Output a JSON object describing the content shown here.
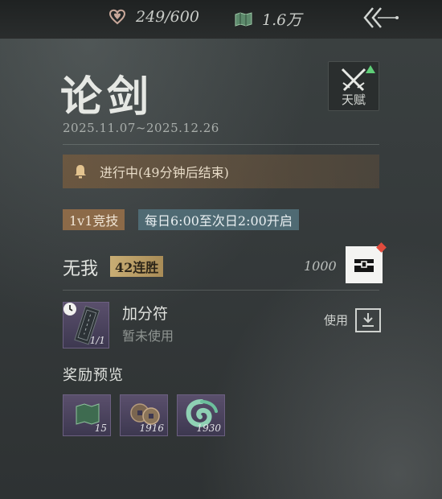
{
  "topbar": {
    "heart_value": "249/600",
    "scroll_value": "1.6万"
  },
  "header": {
    "title": "论剑",
    "date_range": "2025.11.07~2025.12.26",
    "talent_label": "天赋"
  },
  "status": {
    "text": "进行中(49分钟后结束)"
  },
  "tags": {
    "mode": "1v1竞技",
    "schedule": "每日6:00至次日2:00开启"
  },
  "player": {
    "name": "无我",
    "streak": "42连胜",
    "score": "1000"
  },
  "item": {
    "name": "加分符",
    "status": "暂未使用",
    "count": "1/1",
    "use_label": "使用"
  },
  "rewards": {
    "title": "奖励预览",
    "items": [
      {
        "name": "scroll-reward",
        "count": "15"
      },
      {
        "name": "coin-reward",
        "count": "1916"
      },
      {
        "name": "jade-reward",
        "count": "1930"
      }
    ]
  },
  "colors": {
    "status_bg": "#7a5c3e",
    "mode_tag": "#8c6a48",
    "schedule_tag": "#4f6a73",
    "streak_tag": "#c8ad74",
    "item_bg": "#4b4460",
    "talent_arrow": "#5fcf78",
    "notify_dot": "#e24b3d"
  }
}
